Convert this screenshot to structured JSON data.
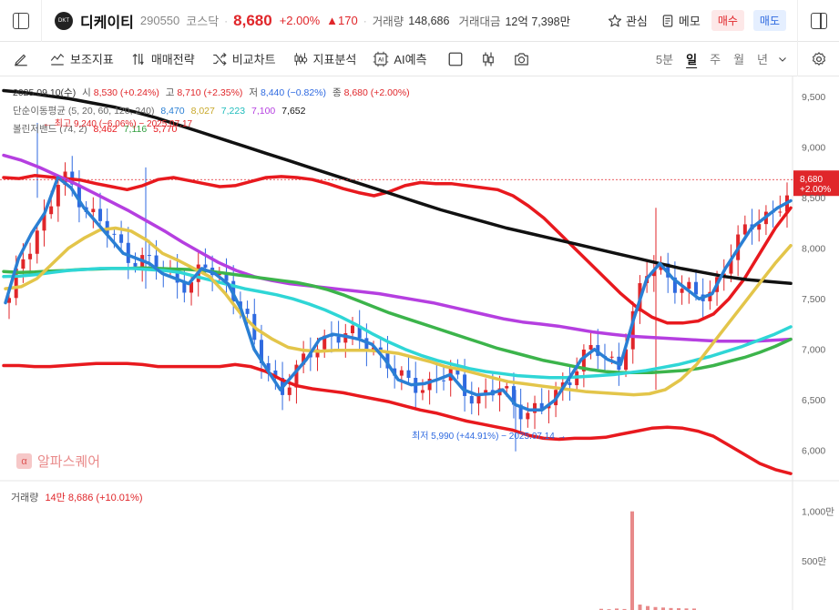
{
  "header": {
    "name": "디케이티",
    "code": "290550",
    "market": "코스닥",
    "logo_text": "DKT",
    "price": "8,680",
    "change_pct": "+2.00%",
    "change_amt": "▲170",
    "volume_label": "거래량",
    "volume": "148,686",
    "amount_label": "거래대금",
    "amount": "12억 7,398만",
    "watch_label": "관심",
    "memo_label": "메모",
    "buy_label": "매수",
    "sell_label": "매도"
  },
  "toolbar": {
    "indicator_label": "보조지표",
    "strategy_label": "매매전략",
    "compare_label": "비교차트",
    "analysis_label": "지표분석",
    "ai_label": "AI예측",
    "periods": [
      "5분",
      "일",
      "주",
      "월",
      "년"
    ],
    "active_period": "일"
  },
  "legend": {
    "ohlc": {
      "date": "2025.09.10(수)",
      "open_label": "시",
      "open": "8,530 (+0.24%)",
      "high_label": "고",
      "high": "8,710 (+2.35%)",
      "low_label": "저",
      "low": "8,440 (−0.82%)",
      "close_label": "종",
      "close": "8,680 (+2.00%)"
    },
    "ma": {
      "label": "단순이동평균 (5, 20, 60, 120, 240)",
      "values": [
        "8,470",
        "8,027",
        "7,223",
        "7,100",
        "7,652"
      ]
    },
    "bollinger": {
      "label": "볼린저밴드 (74, 2)",
      "values": [
        "8,462",
        "7,116",
        "5,770"
      ]
    }
  },
  "annotations": {
    "high": "최고 9,240 (−6.06%) − 2025.07.17",
    "low": "최저 5,990 (+44.91%) − 2025.07.14"
  },
  "watermark": "알파스퀘어",
  "price_axis": [
    "9,500",
    "9,000",
    "8,500",
    "8,000",
    "7,500",
    "7,000",
    "6,500",
    "6,000"
  ],
  "price_tag": {
    "price": "8,680",
    "change": "+2.00%"
  },
  "volume": {
    "label": "거래량",
    "value": "14만 8,686 (+10.01%)",
    "axis": [
      "1,000만",
      "500만"
    ]
  },
  "colors": {
    "up": "#e0262a",
    "down": "#2f6ae0",
    "ma5": "#2a7fd4",
    "ma20": "#e3c54a",
    "ma60": "#2fd6d6",
    "ma120": "#b53fe0",
    "ma240": "#111111",
    "boll_mid": "#3cb44b",
    "boll_band": "#e8191e"
  },
  "chart_data": {
    "type": "candlestick",
    "y_range": [
      5700,
      9700
    ],
    "volume_unit": "만",
    "bollinger_upper": [
      8700,
      8690,
      8720,
      8705,
      8690,
      8675,
      8640,
      8610,
      8580,
      8620,
      8680,
      8700,
      8670,
      8640,
      8610,
      8620,
      8660,
      8700,
      8710,
      8700,
      8680,
      8640,
      8590,
      8550,
      8520,
      8560,
      8620,
      8650,
      8640,
      8640,
      8620,
      8600,
      8580,
      8520,
      8420,
      8300,
      8150,
      8000,
      7850,
      7700,
      7550,
      7420,
      7320,
      7260,
      7260,
      7280,
      7350,
      7500,
      7700,
      7950,
      8200,
      8400
    ],
    "bollinger_mid": [
      7770,
      7760,
      7765,
      7775,
      7780,
      7790,
      7795,
      7800,
      7800,
      7805,
      7800,
      7795,
      7790,
      7780,
      7760,
      7740,
      7720,
      7700,
      7680,
      7660,
      7630,
      7590,
      7540,
      7480,
      7420,
      7360,
      7310,
      7260,
      7210,
      7160,
      7110,
      7060,
      7010,
      6970,
      6930,
      6890,
      6860,
      6830,
      6800,
      6780,
      6770,
      6770,
      6770,
      6780,
      6790,
      6810,
      6840,
      6880,
      6920,
      6970,
      7030,
      7100
    ],
    "bollinger_lower": [
      6840,
      6840,
      6830,
      6830,
      6840,
      6850,
      6860,
      6860,
      6860,
      6850,
      6830,
      6830,
      6830,
      6830,
      6830,
      6850,
      6830,
      6780,
      6700,
      6640,
      6610,
      6590,
      6570,
      6540,
      6510,
      6480,
      6440,
      6400,
      6370,
      6330,
      6290,
      6260,
      6230,
      6200,
      6150,
      6120,
      6110,
      6120,
      6120,
      6130,
      6160,
      6190,
      6220,
      6230,
      6220,
      6190,
      6140,
      6050,
      5960,
      5870,
      5810,
      5770
    ],
    "ma5": [
      7460,
      7900,
      8150,
      8350,
      8700,
      8600,
      8400,
      8250,
      8100,
      7950,
      7900,
      7850,
      7750,
      7700,
      7650,
      7800,
      7750,
      7650,
      7400,
      7000,
      6800,
      6600,
      6750,
      6900,
      7100,
      7150,
      7130,
      7100,
      7050,
      6900,
      6700,
      6650,
      6660,
      6700,
      6750,
      6600,
      6550,
      6560,
      6600,
      6450,
      6400,
      6400,
      6500,
      6700,
      6900,
      7000,
      6900,
      6850,
      7300,
      7700,
      7850,
      7700,
      7600,
      7500,
      7550,
      7800,
      8000,
      8200,
      8300,
      8400,
      8470
    ],
    "ma20": [
      7600,
      7620,
      7700,
      7850,
      8000,
      8100,
      8180,
      8200,
      8170,
      8080,
      7950,
      7880,
      7800,
      7720,
      7550,
      7350,
      7200,
      7100,
      7020,
      6990,
      6980,
      6990,
      6990,
      6990,
      6980,
      6960,
      6920,
      6880,
      6830,
      6800,
      6760,
      6720,
      6680,
      6660,
      6640,
      6620,
      6600,
      6580,
      6570,
      6560,
      6550,
      6560,
      6600,
      6700,
      6850,
      7050,
      7250,
      7450,
      7650,
      7850,
      8027
    ],
    "ma60": [
      7720,
      7725,
      7740,
      7760,
      7780,
      7790,
      7800,
      7800,
      7800,
      7790,
      7780,
      7760,
      7720,
      7680,
      7640,
      7600,
      7570,
      7540,
      7500,
      7450,
      7390,
      7320,
      7240,
      7150,
      7070,
      7000,
      6940,
      6890,
      6850,
      6810,
      6780,
      6760,
      6740,
      6730,
      6720,
      6720,
      6730,
      6740,
      6750,
      6770,
      6790,
      6820,
      6850,
      6890,
      6930,
      6980,
      7030,
      7090,
      7150,
      7223
    ],
    "ma120": [
      8920,
      8870,
      8800,
      8720,
      8640,
      8550,
      8460,
      8370,
      8270,
      8170,
      8060,
      7960,
      7860,
      7780,
      7720,
      7680,
      7650,
      7630,
      7610,
      7590,
      7570,
      7550,
      7520,
      7490,
      7460,
      7420,
      7380,
      7340,
      7300,
      7270,
      7250,
      7230,
      7200,
      7170,
      7150,
      7130,
      7120,
      7110,
      7100,
      7090,
      7080,
      7080,
      7080,
      7090,
      7100
    ],
    "ma240": [
      9560,
      9540,
      9510,
      9480,
      9440,
      9400,
      9350,
      9290,
      9220,
      9150,
      9080,
      9010,
      8940,
      8870,
      8800,
      8730,
      8660,
      8590,
      8520,
      8450,
      8380,
      8320,
      8260,
      8200,
      8150,
      8100,
      8050,
      8000,
      7950,
      7900,
      7850,
      7800,
      7760,
      7720,
      7690,
      7670,
      7652
    ],
    "volume_last_bars": [
      12,
      8,
      15,
      10,
      1000,
      55,
      40,
      30,
      25,
      20,
      18,
      16,
      14.8686
    ]
  }
}
